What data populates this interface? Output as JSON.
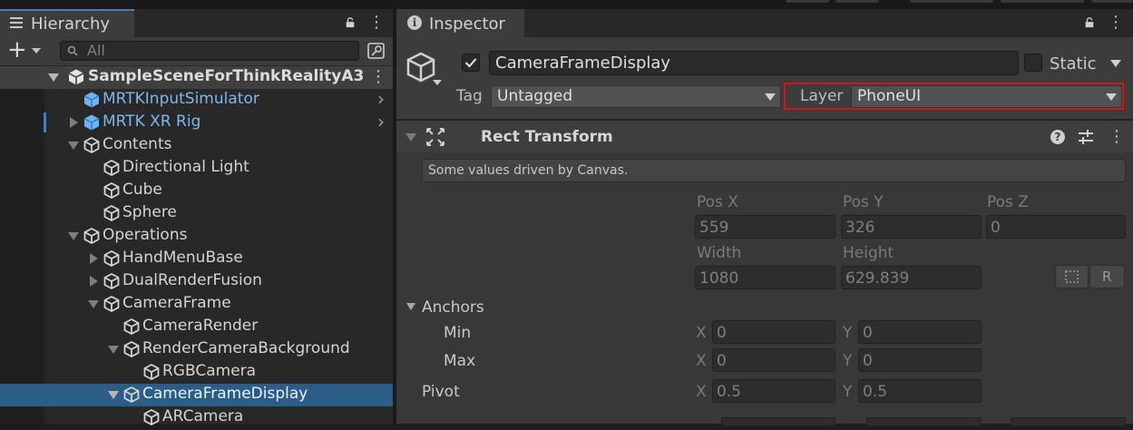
{
  "hierarchy": {
    "tab_title": "Hierarchy",
    "search_placeholder": "All",
    "add_symbol": "+",
    "lock_symbol": "🔒",
    "menu_symbol": "⋮",
    "items": [
      {
        "label": "SampleSceneForThinkRealityA3*",
        "depth": 0,
        "expand": "open",
        "kind": "scene"
      },
      {
        "label": "MRTKInputSimulator",
        "depth": 1,
        "expand": "none",
        "kind": "prefab",
        "chevron": true
      },
      {
        "label": "MRTK XR Rig",
        "depth": 1,
        "expand": "closed",
        "kind": "prefab",
        "chevron": true
      },
      {
        "label": "Contents",
        "depth": 1,
        "expand": "open",
        "kind": "object"
      },
      {
        "label": "Directional Light",
        "depth": 2,
        "expand": "none",
        "kind": "object"
      },
      {
        "label": "Cube",
        "depth": 2,
        "expand": "none",
        "kind": "object"
      },
      {
        "label": "Sphere",
        "depth": 2,
        "expand": "none",
        "kind": "object"
      },
      {
        "label": "Operations",
        "depth": 1,
        "expand": "open",
        "kind": "object"
      },
      {
        "label": "HandMenuBase",
        "depth": 2,
        "expand": "closed",
        "kind": "object"
      },
      {
        "label": "DualRenderFusion",
        "depth": 2,
        "expand": "closed",
        "kind": "object"
      },
      {
        "label": "CameraFrame",
        "depth": 2,
        "expand": "open",
        "kind": "object"
      },
      {
        "label": "CameraRender",
        "depth": 3,
        "expand": "none",
        "kind": "object"
      },
      {
        "label": "RenderCameraBackground",
        "depth": 3,
        "expand": "open",
        "kind": "object"
      },
      {
        "label": "RGBCamera",
        "depth": 4,
        "expand": "none",
        "kind": "object"
      },
      {
        "label": "CameraFrameDisplay",
        "depth": 3,
        "expand": "open",
        "kind": "object",
        "selected": true
      },
      {
        "label": "ARCamera",
        "depth": 4,
        "expand": "none",
        "kind": "object"
      }
    ]
  },
  "inspector": {
    "tab_title": "Inspector",
    "object_name": "CameraFrameDisplay",
    "active": true,
    "static_label": "Static",
    "tag_label": "Tag",
    "tag_value": "Untagged",
    "layer_label": "Layer",
    "layer_value": "PhoneUI",
    "layer_highlight_color": "#d0161a",
    "component": {
      "title": "Rect Transform",
      "note": "Some values driven by Canvas.",
      "pos_x_label": "Pos X",
      "pos_y_label": "Pos Y",
      "pos_z_label": "Pos Z",
      "pos_x": "559",
      "pos_y": "326",
      "pos_z": "0",
      "width_label": "Width",
      "height_label": "Height",
      "width": "1080",
      "height": "629.839",
      "r_button": "R",
      "anchors_label": "Anchors",
      "min_label": "Min",
      "max_label": "Max",
      "pivot_label": "Pivot",
      "x_label": "X",
      "y_label": "Y",
      "min_x": "0",
      "min_y": "0",
      "max_x": "0",
      "max_y": "0",
      "pivot_x": "0.5",
      "pivot_y": "0.5"
    }
  },
  "colors": {
    "selection": "#2c5d87",
    "prefab_text": "#7db7ee",
    "accent_tab": "#4a7bb5"
  }
}
